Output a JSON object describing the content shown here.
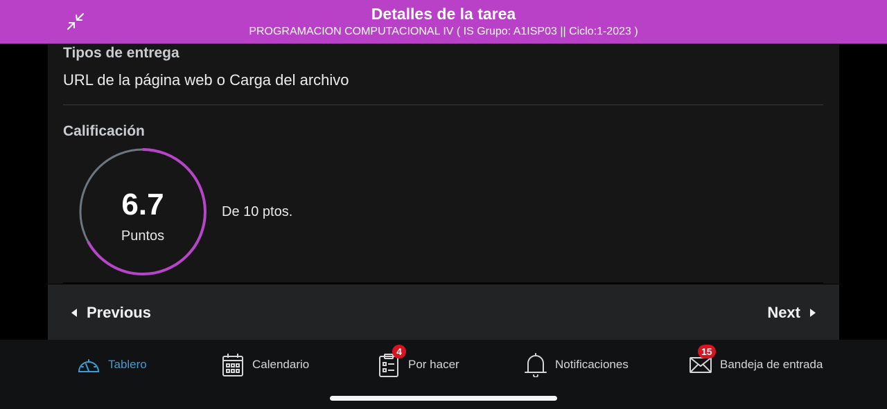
{
  "header": {
    "title": "Detalles de la tarea",
    "subtitle": "PROGRAMACION COMPUTACIONAL IV ( IS Grupo: A1ISP03 || Ciclo:1-2023 )",
    "background_color": "#b941c7",
    "collapse_icon": "collapse-arrows-icon"
  },
  "submission": {
    "label": "Tipos de entrega",
    "value": "URL de la página web o Carga del archivo"
  },
  "grade": {
    "label": "Calificación",
    "score": "6.7",
    "unit": "Puntos",
    "out_of": "De 10 ptos.",
    "score_fraction": 0.67,
    "ring_color": "#b745c9",
    "track_color": "#6e7780"
  },
  "pager": {
    "previous": "Previous",
    "next": "Next"
  },
  "tabbar": {
    "accent_color": "#3a9fd6",
    "badge_color": "#d7141f",
    "tabs": [
      {
        "label": "Tablero",
        "icon": "dashboard-gauge-icon",
        "active": true,
        "badge": ""
      },
      {
        "label": "Calendario",
        "icon": "calendar-icon",
        "active": false,
        "badge": ""
      },
      {
        "label": "Por hacer",
        "icon": "todo-clipboard-icon",
        "active": false,
        "badge": "4"
      },
      {
        "label": "Notificaciones",
        "icon": "bell-icon",
        "active": false,
        "badge": ""
      },
      {
        "label": "Bandeja de entrada",
        "icon": "mail-icon",
        "active": false,
        "badge": "15"
      }
    ]
  }
}
